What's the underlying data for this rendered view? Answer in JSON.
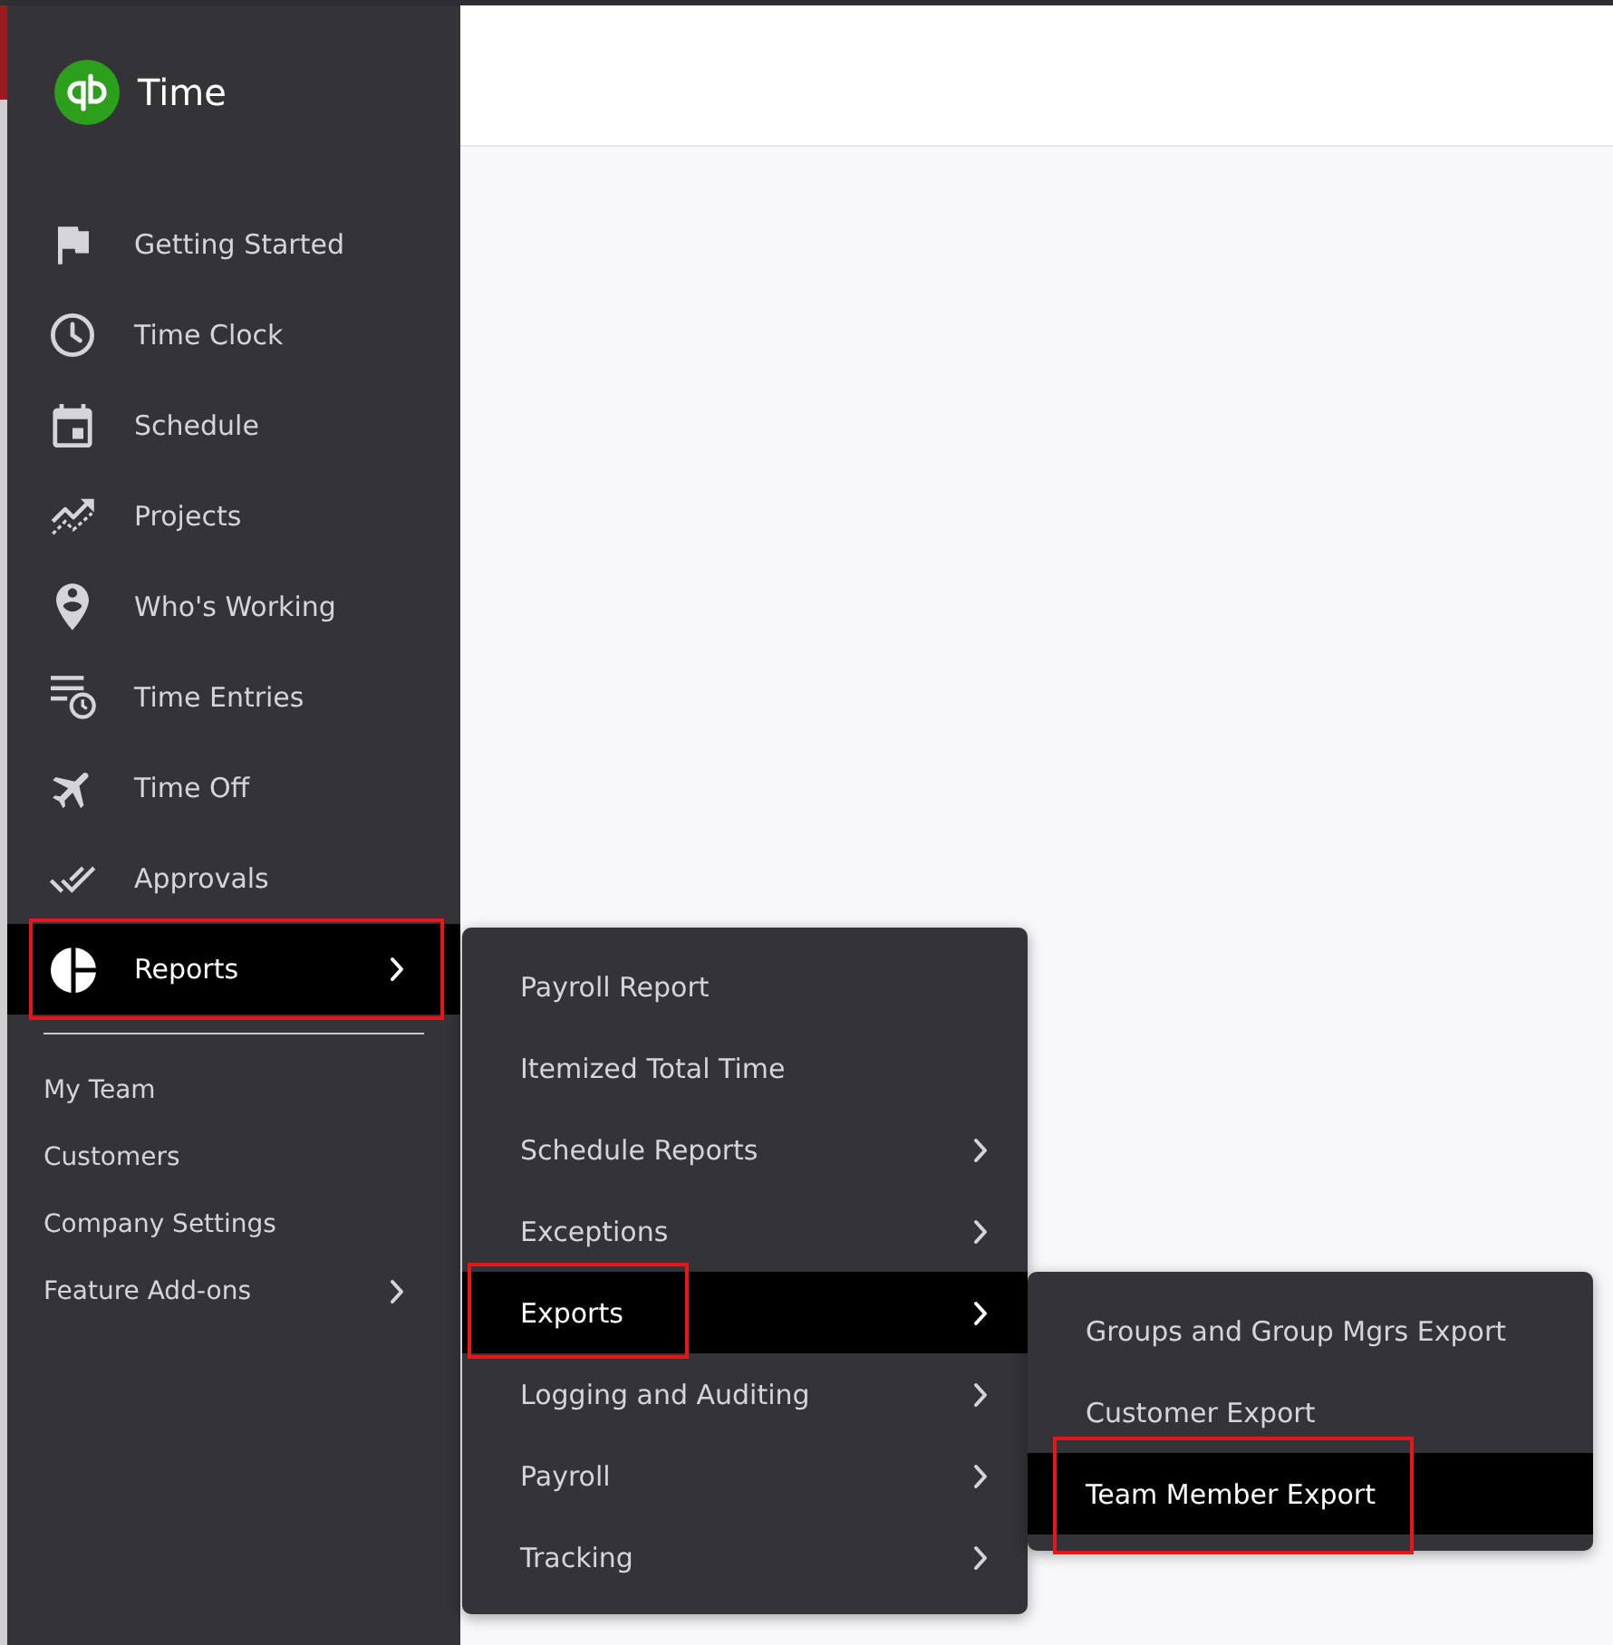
{
  "app": {
    "name": "Time"
  },
  "nav": {
    "items": [
      {
        "label": "Getting Started",
        "selected": false,
        "has_submenu": false,
        "annotated": false
      },
      {
        "label": "Time Clock",
        "selected": false,
        "has_submenu": false,
        "annotated": false
      },
      {
        "label": "Schedule",
        "selected": false,
        "has_submenu": false,
        "annotated": false
      },
      {
        "label": "Projects",
        "selected": false,
        "has_submenu": false,
        "annotated": false
      },
      {
        "label": "Who's Working",
        "selected": false,
        "has_submenu": false,
        "annotated": false
      },
      {
        "label": "Time Entries",
        "selected": false,
        "has_submenu": false,
        "annotated": false
      },
      {
        "label": "Time Off",
        "selected": false,
        "has_submenu": false,
        "annotated": false
      },
      {
        "label": "Approvals",
        "selected": false,
        "has_submenu": false,
        "annotated": false
      },
      {
        "label": "Reports",
        "selected": true,
        "has_submenu": true,
        "annotated": true
      }
    ]
  },
  "secondary_nav": {
    "items": [
      {
        "label": "My Team",
        "has_submenu": false
      },
      {
        "label": "Customers",
        "has_submenu": false
      },
      {
        "label": "Company Settings",
        "has_submenu": false
      },
      {
        "label": "Feature Add-ons",
        "has_submenu": true
      }
    ]
  },
  "reports_menu": {
    "items": [
      {
        "label": "Payroll Report",
        "selected": false,
        "has_submenu": false,
        "annotated": false
      },
      {
        "label": "Itemized Total Time",
        "selected": false,
        "has_submenu": false,
        "annotated": false
      },
      {
        "label": "Schedule Reports",
        "selected": false,
        "has_submenu": true,
        "annotated": false
      },
      {
        "label": "Exceptions",
        "selected": false,
        "has_submenu": true,
        "annotated": false
      },
      {
        "label": "Exports",
        "selected": true,
        "has_submenu": true,
        "annotated": true
      },
      {
        "label": "Logging and Auditing",
        "selected": false,
        "has_submenu": true,
        "annotated": false
      },
      {
        "label": "Payroll",
        "selected": false,
        "has_submenu": true,
        "annotated": false
      },
      {
        "label": "Tracking",
        "selected": false,
        "has_submenu": true,
        "annotated": false
      }
    ]
  },
  "exports_menu": {
    "items": [
      {
        "label": "Groups and Group Mgrs Export",
        "selected": false,
        "has_submenu": false,
        "annotated": false
      },
      {
        "label": "Customer Export",
        "selected": false,
        "has_submenu": false,
        "annotated": false
      },
      {
        "label": "Team Member Export",
        "selected": true,
        "has_submenu": false,
        "annotated": true
      }
    ]
  }
}
